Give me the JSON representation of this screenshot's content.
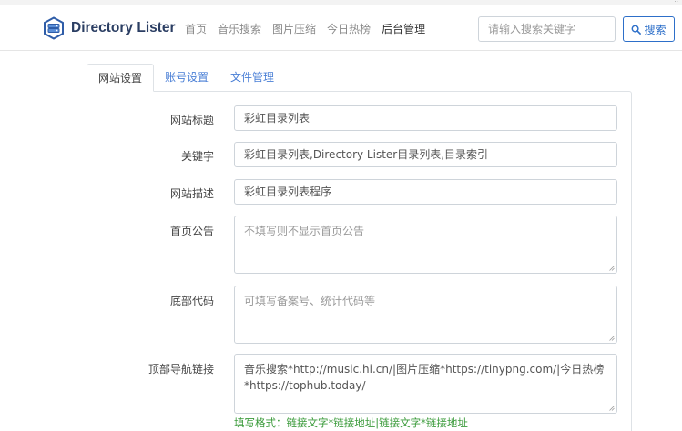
{
  "brand": {
    "name": "Directory Lister"
  },
  "nav": {
    "links": [
      "首页",
      "音乐搜索",
      "图片压缩",
      "今日热榜",
      "后台管理"
    ],
    "active_index": 4
  },
  "search": {
    "placeholder": "请输入搜索关键字",
    "button_label": "搜索"
  },
  "tabs": [
    "网站设置",
    "账号设置",
    "文件管理"
  ],
  "form": {
    "site_title": {
      "label": "网站标题",
      "value": "彩虹目录列表"
    },
    "keywords": {
      "label": "关键字",
      "value": "彩虹目录列表,Directory Lister目录列表,目录索引"
    },
    "description": {
      "label": "网站描述",
      "value": "彩虹目录列表程序"
    },
    "announcement": {
      "label": "首页公告",
      "placeholder": "不填写则不显示首页公告"
    },
    "footer_code": {
      "label": "底部代码",
      "placeholder": "可填写备案号、统计代码等"
    },
    "nav_links": {
      "label": "顶部导航链接",
      "value": "音乐搜索*http://music.hi.cn/|图片压缩*https://tinypng.com/|今日热榜*https://tophub.today/",
      "hint": "填写格式：链接文字*链接地址|链接文字*链接地址"
    }
  },
  "colors": {
    "brand_text": "#2b3e63",
    "link": "#4a7fd6",
    "primary": "#2d6fc9",
    "hint": "#3b9b3b"
  },
  "icons": {
    "logo": "directory-drive-icon",
    "search": "search-icon",
    "resize": "resize-grip-icon"
  }
}
